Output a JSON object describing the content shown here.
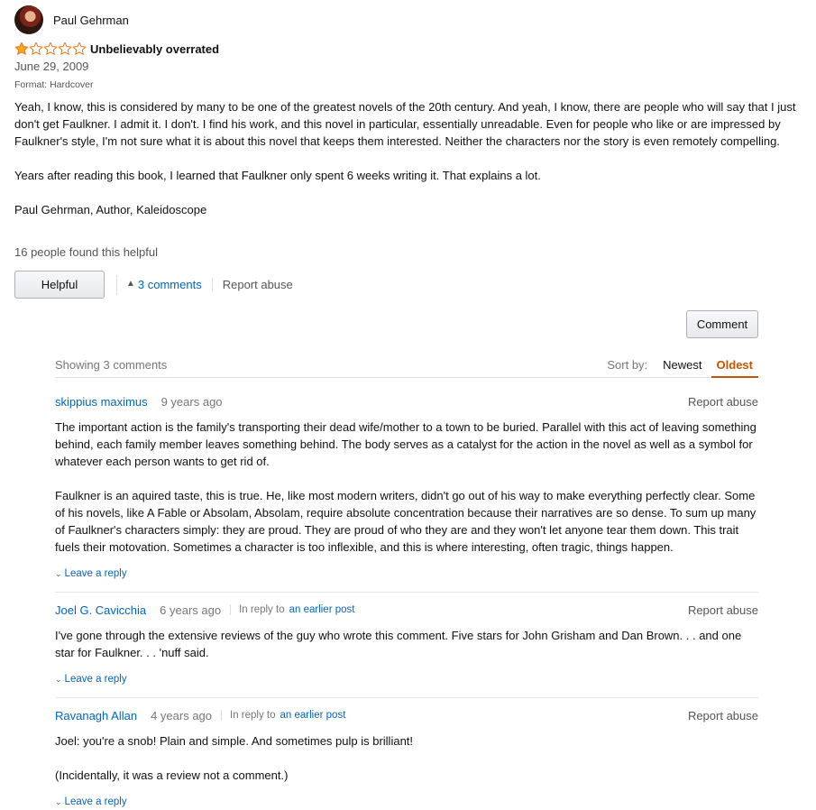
{
  "review": {
    "reviewer_name": "Paul Gehrman",
    "rating": 1,
    "max_rating": 5,
    "title": "Unbelievably overrated",
    "date": "June 29, 2009",
    "format": "Format: Hardcover",
    "body": [
      "Yeah, I know, this is considered by many to be one of the greatest novels of the 20th century. And yeah, I know, there are people who will say that I just don't get Faulkner. I admit it. I don't. I find his work, and this novel in particular, essentially unreadable. Even for people who like or are impressed by Faulkner's style, I'm not sure what it is about this novel that keeps them interested. Neither the characters nor the story is even remotely compelling.",
      "Years after reading this book, I learned that Faulkner only spent 6 weeks writing it. That explains a lot.",
      "Paul Gehrman, Author, Kaleidoscope"
    ],
    "helpful_count": "16 people found this helpful",
    "helpful_button": "Helpful",
    "comments_link": "3 comments",
    "report_abuse": "Report abuse"
  },
  "comment_button": "Comment",
  "comments_section": {
    "showing": "Showing 3 comments",
    "sort_label": "Sort by:",
    "sort_newest": "Newest",
    "sort_oldest": "Oldest",
    "comments": [
      {
        "author": "skippius maximus",
        "age": "9 years ago",
        "report": "Report abuse",
        "paragraphs": [
          "The important action is the family's transporting their dead wife/mother to a town to be buried. Parallel with this act of leaving something behind, each family member leaves something behind. The body serves as a catalyst for the action in the novel as well as a symbol for whatever each person wants to get rid of.",
          "Faulkner is an aquired taste, this is true. He, like most modern writers, didn't go out of his way to make everything perfectly clear. Some of his novels, like A Fable or Absolam, Absolam, require absolute concentration because their narratives are so dense. To sum up many of Faulkner's characters simply: they are proud. They are proud of who they are and they won't let anyone tear them down. This trait fuels their motovation. Sometimes a character is too inflexible, and this is where interesting, often tragic, things happen."
        ],
        "leave_reply": "Leave a reply"
      },
      {
        "author": "Joel G. Cavicchia",
        "age": "6 years ago",
        "reply_to_label": "In reply to",
        "reply_to_link": "an earlier post",
        "report": "Report abuse",
        "paragraphs": [
          "I've gone through the extensive reviews of the guy who wrote this comment. Five stars for John Grisham and Dan Brown. . . and one star for Faulkner. . . 'nuff said."
        ],
        "leave_reply": "Leave a reply"
      },
      {
        "author": "Ravanagh Allan",
        "age": "4 years ago",
        "reply_to_label": "In reply to",
        "reply_to_link": "an earlier post",
        "report": "Report abuse",
        "paragraphs": [
          "Joel: you're a snob! Plain and simple. And sometimes pulp is brilliant!",
          "(Incidentally, it was a review not a comment.)"
        ],
        "leave_reply": "Leave a reply"
      }
    ]
  },
  "colors": {
    "link": "#0066c0",
    "star_fill": "#ffa41c",
    "star_outline": "#de7921",
    "sort_active": "#c45500"
  },
  "icons": {
    "star": "star-icon",
    "caret_up": "caret-up-icon",
    "chevron_down": "chevron-down-icon"
  }
}
